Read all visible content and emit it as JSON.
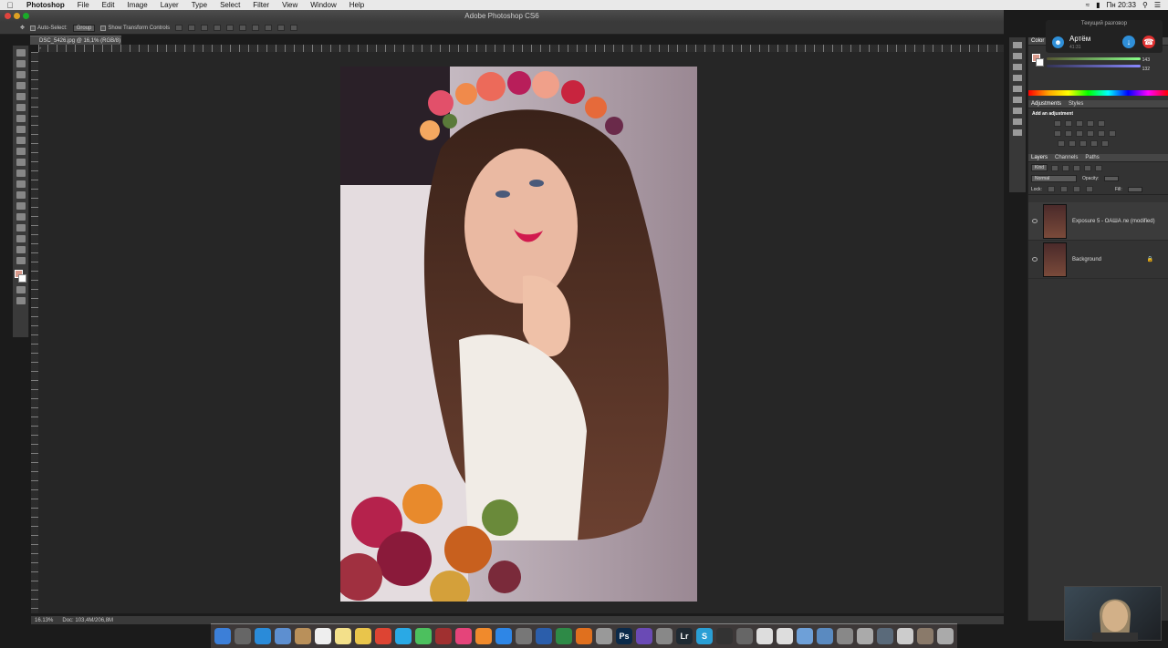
{
  "menubar": {
    "app": "Photoshop",
    "items": [
      "File",
      "Edit",
      "Image",
      "Layer",
      "Type",
      "Select",
      "Filter",
      "View",
      "Window",
      "Help"
    ],
    "clock": "Пн 20:33"
  },
  "window": {
    "title": "Adobe Photoshop CS6"
  },
  "options": {
    "auto_select": "Auto-Select:",
    "auto_select_value": "Group",
    "show_transform": "Show Transform Controls"
  },
  "document": {
    "tab": "DSC_5426.jpg @ 16,1% (RGB/8) *",
    "zoom": "16.13%",
    "doc_info": "Doc: 103,4M/206,8M"
  },
  "call": {
    "header": "Текущий разговор",
    "name": "Артём",
    "time": "41:31"
  },
  "color_panel": {
    "tab": "Color",
    "values": [
      "143",
      "132"
    ]
  },
  "adjustments": {
    "tabs": [
      "Adjustments",
      "Styles"
    ],
    "label": "Add an adjustment"
  },
  "layers_panel": {
    "tabs": [
      "Layers",
      "Channels",
      "Paths"
    ],
    "kind": "Kind",
    "blend": "Normal",
    "opacity_label": "Opacity:",
    "lock_label": "Lock:",
    "fill_label": "Fill:",
    "layers": [
      {
        "name": "Exposure 5 - ОАША ле (modified)"
      },
      {
        "name": "Background"
      }
    ]
  },
  "colors": {
    "foreground": "#d99a8c",
    "accent": "#2f8fd8",
    "hangup": "#e03030"
  },
  "dock": [
    {
      "icon": "finder-icon",
      "color": "#3c7fd8"
    },
    {
      "icon": "launchpad-icon",
      "color": "#666"
    },
    {
      "icon": "safari-icon",
      "color": "#2a8bd9"
    },
    {
      "icon": "preview-icon",
      "color": "#5d8fd0"
    },
    {
      "icon": "notes-icon",
      "color": "#b9905a"
    },
    {
      "icon": "calendar-icon",
      "color": "#eee"
    },
    {
      "icon": "stickies-icon",
      "color": "#f3e08a"
    },
    {
      "icon": "photos-icon",
      "color": "#e9c54b"
    },
    {
      "icon": "chrome-icon",
      "color": "#dd4433"
    },
    {
      "icon": "skype-icon",
      "color": "#2aa9e5"
    },
    {
      "icon": "messages-icon",
      "color": "#4cc05e"
    },
    {
      "icon": "photobooth-icon",
      "color": "#a03030"
    },
    {
      "icon": "itunes-icon",
      "color": "#e5447a"
    },
    {
      "icon": "ibooks-icon",
      "color": "#f08a2c"
    },
    {
      "icon": "appstore-icon",
      "color": "#2e86e6"
    },
    {
      "icon": "preferences-icon",
      "color": "#777"
    },
    {
      "icon": "word-icon",
      "color": "#2b5eab"
    },
    {
      "icon": "excel-icon",
      "color": "#2e8a47"
    },
    {
      "icon": "firefox-icon",
      "color": "#e0701e"
    },
    {
      "icon": "folder-icon",
      "color": "#999"
    },
    {
      "icon": "photoshop-icon",
      "color": "#0b2a4a",
      "label": "Ps"
    },
    {
      "icon": "star-icon",
      "color": "#6a4ab5"
    },
    {
      "icon": "grid-icon",
      "color": "#888"
    },
    {
      "icon": "lightroom-icon",
      "color": "#1f2a33",
      "label": "Lr"
    },
    {
      "icon": "s-icon",
      "color": "#2a9fd5",
      "label": "S"
    },
    {
      "icon": "obs-icon",
      "color": "#333"
    },
    {
      "icon": "calculator-icon",
      "color": "#666"
    },
    {
      "icon": "doc-icon",
      "color": "#ddd"
    },
    {
      "icon": "textedit-icon",
      "color": "#ddd"
    },
    {
      "icon": "image1-icon",
      "color": "#6ea0d8"
    },
    {
      "icon": "image2-icon",
      "color": "#5a8ac0"
    },
    {
      "icon": "image3-icon",
      "color": "#888"
    },
    {
      "icon": "image4-icon",
      "color": "#aaa"
    },
    {
      "icon": "image5-icon",
      "color": "#5a6a7a"
    },
    {
      "icon": "image6-icon",
      "color": "#ccc"
    },
    {
      "icon": "image7-icon",
      "color": "#8a7a6a"
    },
    {
      "icon": "trash-icon",
      "color": "#aaa"
    }
  ]
}
